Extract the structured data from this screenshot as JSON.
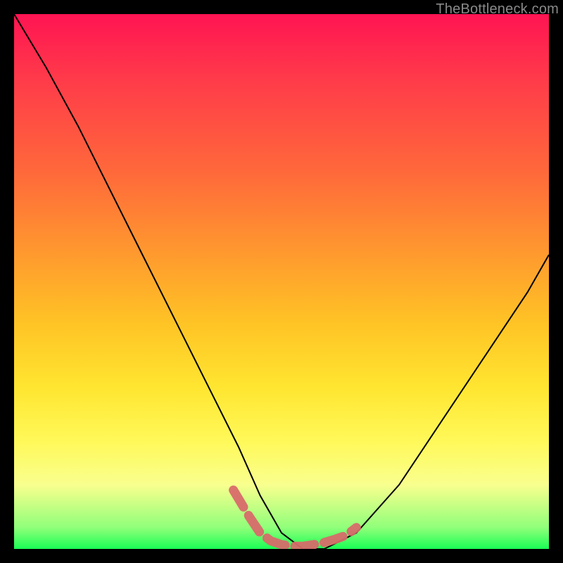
{
  "watermark": "TheBottleneck.com",
  "chart_data": {
    "type": "line",
    "title": "",
    "xlabel": "",
    "ylabel": "",
    "xlim": [
      0,
      100
    ],
    "ylim": [
      0,
      100
    ],
    "grid": false,
    "legend": false,
    "series": [
      {
        "name": "bottleneck-curve",
        "stroke": "#000000",
        "x": [
          0,
          6,
          12,
          18,
          24,
          30,
          36,
          42,
          46,
          50,
          54,
          58,
          64,
          72,
          80,
          88,
          96,
          100
        ],
        "values": [
          100,
          90,
          79,
          67,
          55,
          43,
          31,
          19,
          10,
          3,
          0,
          0,
          3,
          12,
          24,
          36,
          48,
          55
        ]
      },
      {
        "name": "sweet-spot-highlight",
        "stroke": "#d86a6a",
        "x": [
          41,
          44,
          46,
          48,
          50,
          52,
          54,
          56,
          58,
          60,
          62,
          64
        ],
        "values": [
          11,
          6,
          3,
          1.5,
          0.8,
          0.5,
          0.5,
          0.8,
          1.2,
          1.8,
          2.5,
          4
        ]
      }
    ],
    "background_gradient": {
      "direction": "top-to-bottom",
      "stops": [
        {
          "pos": 0,
          "color": "#ff1452"
        },
        {
          "pos": 45,
          "color": "#ff9a2e"
        },
        {
          "pos": 75,
          "color": "#fff95a"
        },
        {
          "pos": 96,
          "color": "#90ff7a"
        },
        {
          "pos": 100,
          "color": "#1aff55"
        }
      ]
    }
  }
}
